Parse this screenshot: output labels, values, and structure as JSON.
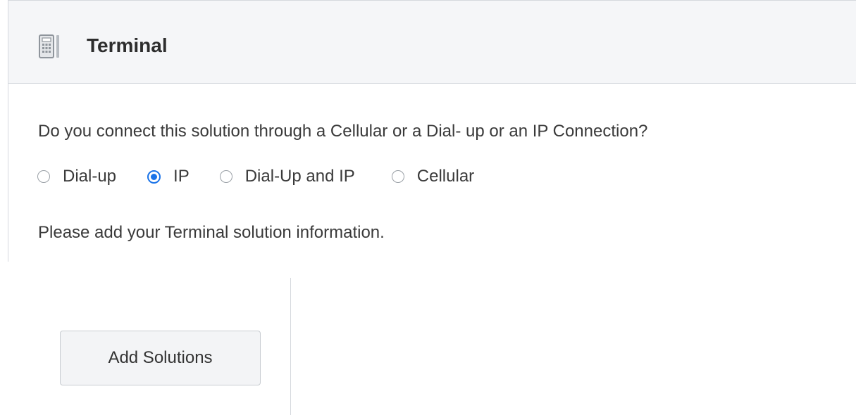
{
  "header": {
    "title": "Terminal",
    "icon": "terminal-icon"
  },
  "question": {
    "text": "Do you connect this solution through a Cellular or a Dial- up or an IP Connection?"
  },
  "connection_options": {
    "selected": "IP",
    "items": [
      {
        "label": "Dial-up",
        "checked": false
      },
      {
        "label": "IP",
        "checked": true
      },
      {
        "label": "Dial-Up and IP",
        "checked": false
      },
      {
        "label": "Cellular",
        "checked": false
      }
    ]
  },
  "info": {
    "text": "Please add your Terminal solution information."
  },
  "actions": {
    "add_solutions_label": "Add Solutions"
  },
  "colors": {
    "accent": "#1a73e8",
    "header_bg": "#f5f6f8",
    "border": "#d5d9de",
    "button_bg": "#f3f4f6"
  }
}
